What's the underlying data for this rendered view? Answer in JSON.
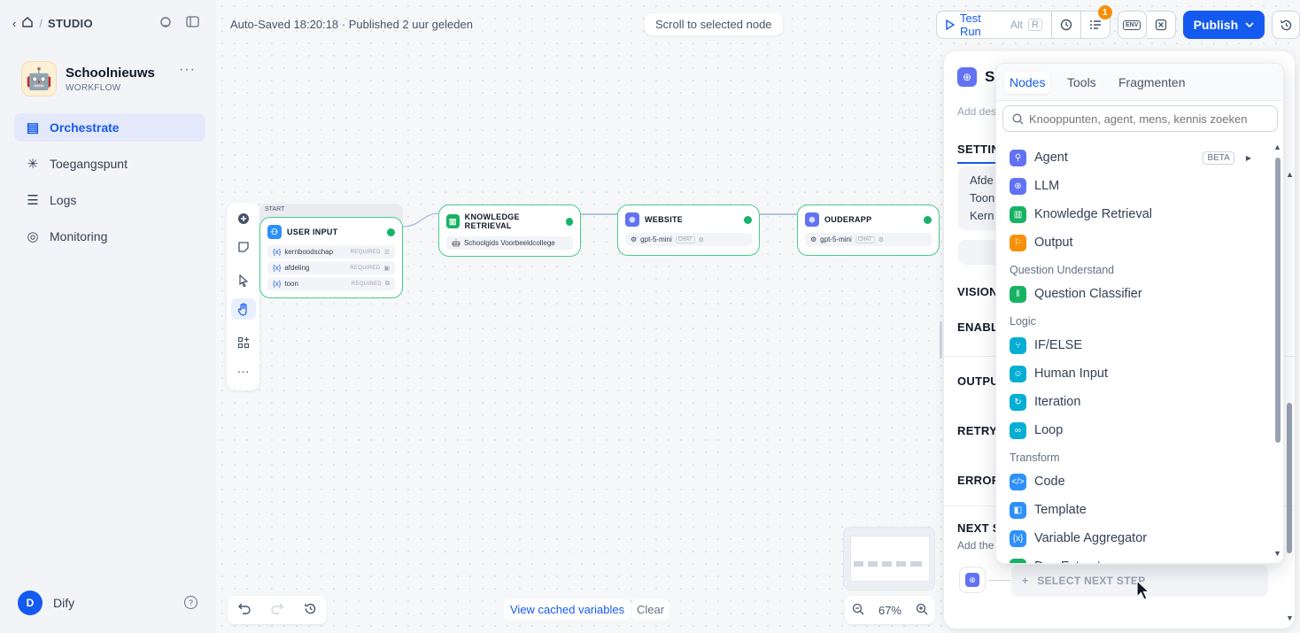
{
  "breadcrumb": {
    "back": "‹",
    "sep": "/",
    "studio": "STUDIO"
  },
  "app": {
    "name": "Schoolnieuws",
    "type": "WORKFLOW",
    "avatar": "🤖",
    "more": "···"
  },
  "nav": [
    {
      "label": "Orchestrate",
      "icon": "orchestrate-icon",
      "glyph": "▤"
    },
    {
      "label": "Toegangspunt",
      "icon": "access-point-icon",
      "glyph": "✳"
    },
    {
      "label": "Logs",
      "icon": "logs-icon",
      "glyph": "☰"
    },
    {
      "label": "Monitoring",
      "icon": "monitoring-icon",
      "glyph": "◎"
    }
  ],
  "user": {
    "initial": "D",
    "name": "Dify"
  },
  "header": {
    "status": "Auto-Saved 18:20:18 · Published 2 uur geleden",
    "scroll_to_selected": "Scroll to selected node",
    "test_run": "Test Run",
    "kbd_alt": "Alt",
    "kbd_r": "R",
    "checklist_badge": "1",
    "env_label": "ENV",
    "publish": "Publish"
  },
  "nodes": {
    "start_label": "START",
    "user_input": {
      "title": "USER INPUT",
      "vars": [
        {
          "name": "kernboodschap",
          "req": "REQUIRED"
        },
        {
          "name": "afdeling",
          "req": "REQUIRED"
        },
        {
          "name": "toon",
          "req": "REQUIRED"
        }
      ]
    },
    "knowledge": {
      "title": "KNOWLEDGE RETRIEVAL",
      "dataset": "Schoolgids Voorbeeldcollege"
    },
    "website": {
      "title": "WEBSITE",
      "model": "gpt-5-mini",
      "chip": "CHAT"
    },
    "ouderapp": {
      "title": "OUDERAPP",
      "model": "gpt-5-mini",
      "chip": "CHAT"
    }
  },
  "bottom": {
    "cached": "View cached variables",
    "clear": "Clear",
    "zoom": "67%"
  },
  "panel": {
    "title": "S",
    "desc": "Add des",
    "settings": "SETTIN",
    "sub_lines": [
      "Afde",
      "Toon",
      "Kern"
    ],
    "vision": "VISION",
    "enable": "ENABL",
    "output": "OUTPU",
    "retry": "RETRY",
    "error": "ERROR",
    "next": "NEXT S",
    "next_desc": "Add the",
    "select_next": "SELECT NEXT STEP"
  },
  "dropdown": {
    "tabs": [
      "Nodes",
      "Tools",
      "Fragmenten"
    ],
    "search_placeholder": "Knooppunten, agent, mens, kennis zoeken",
    "beta": "BETA",
    "items": [
      {
        "type": "item",
        "label": "Agent",
        "color": "#6172f3",
        "glyph": "⚲",
        "beta": true
      },
      {
        "type": "item",
        "label": "LLM",
        "color": "#6172f3",
        "glyph": "⊕"
      },
      {
        "type": "item",
        "label": "Knowledge Retrieval",
        "color": "#16b364",
        "glyph": "▥"
      },
      {
        "type": "item",
        "label": "Output",
        "color": "#f79009",
        "glyph": "⚐"
      },
      {
        "type": "cat",
        "label": "Question Understand"
      },
      {
        "type": "item",
        "label": "Question Classifier",
        "color": "#16b364",
        "glyph": "‖"
      },
      {
        "type": "cat",
        "label": "Logic"
      },
      {
        "type": "item",
        "label": "IF/ELSE",
        "color": "#06aed4",
        "glyph": "⑂"
      },
      {
        "type": "item",
        "label": "Human Input",
        "color": "#06aed4",
        "glyph": "☺"
      },
      {
        "type": "item",
        "label": "Iteration",
        "color": "#06aed4",
        "glyph": "↻"
      },
      {
        "type": "item",
        "label": "Loop",
        "color": "#06aed4",
        "glyph": "∞"
      },
      {
        "type": "cat",
        "label": "Transform"
      },
      {
        "type": "item",
        "label": "Code",
        "color": "#2e90fa",
        "glyph": "</>"
      },
      {
        "type": "item",
        "label": "Template",
        "color": "#2e90fa",
        "glyph": "◧"
      },
      {
        "type": "item",
        "label": "Variable Aggregator",
        "color": "#2e90fa",
        "glyph": "{x}"
      },
      {
        "type": "item",
        "label": "Doc Extractor",
        "color": "#16b364",
        "glyph": "▤"
      }
    ]
  }
}
